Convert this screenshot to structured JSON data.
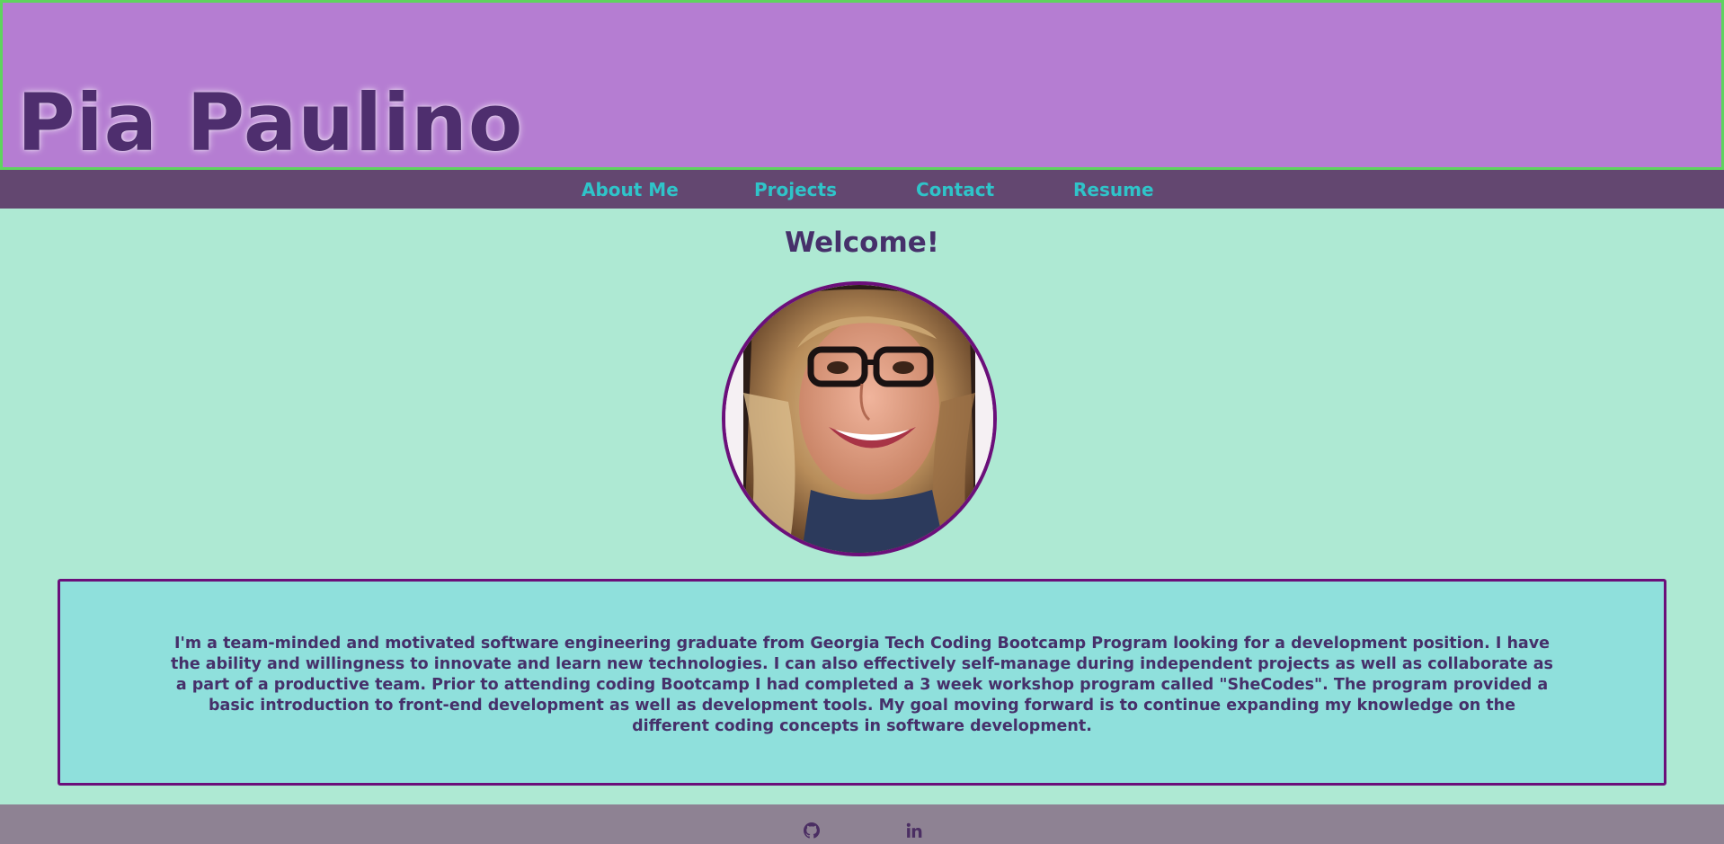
{
  "header": {
    "title": "Pia Paulino"
  },
  "nav": {
    "items": [
      {
        "label": "About Me"
      },
      {
        "label": "Projects"
      },
      {
        "label": "Contact"
      },
      {
        "label": "Resume"
      }
    ]
  },
  "main": {
    "heading": "Welcome!",
    "bio": "I'm a team-minded and motivated software engineering graduate from Georgia Tech Coding Bootcamp Program looking for a development position. I have the ability and willingness to innovate and learn new technologies. I can also effectively self-manage during independent projects as well as collaborate as a part of a productive team. Prior to attending coding Bootcamp I had completed a 3 week workshop program called \"SheCodes\". The program provided a basic introduction to front-end development as well as development tools. My goal moving forward is to continue expanding my knowledge on the different coding concepts in software development."
  },
  "footer": {
    "icons": [
      "github-icon",
      "linkedin-icon"
    ]
  },
  "colors": {
    "header_bg": "#b57dd2",
    "header_border": "#5fd35f",
    "nav_bg": "#634770",
    "nav_link": "#2fc4c9",
    "page_bg": "#aee9d3",
    "bio_bg": "#8fe0dc",
    "accent_border": "#6b0f7a",
    "footer_bg": "#8e8293",
    "text": "#46306a"
  }
}
